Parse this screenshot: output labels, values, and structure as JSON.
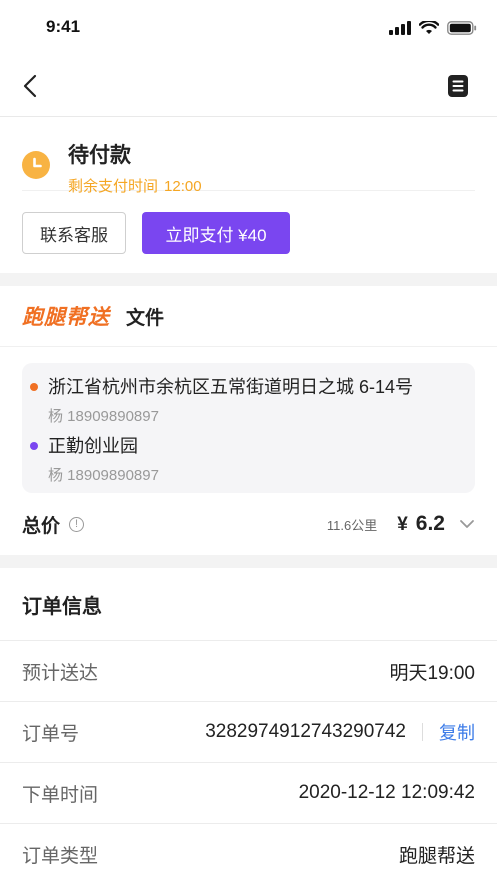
{
  "status_bar": {
    "time": "9:41"
  },
  "order_status": {
    "title": "待付款",
    "remaining_label": "剩余支付时间",
    "remaining_time": "12:00"
  },
  "actions": {
    "contact_label": "联系客服",
    "pay_label": "立即支付 ¥40"
  },
  "service": {
    "brand": "跑腿帮送",
    "type": "文件"
  },
  "addresses": [
    {
      "address": "浙江省杭州市余杭区五常街道明日之城 6-14号",
      "contact": "杨 18909890897"
    },
    {
      "address": "正勤创业园",
      "contact": "杨 18909890897"
    }
  ],
  "total": {
    "label": "总价",
    "distance": "11.6公里",
    "currency": "¥",
    "price": "6.2"
  },
  "order_info": {
    "title": "订单信息",
    "eta_label": "预计送达",
    "eta_value": "明天19:00",
    "order_no_label": "订单号",
    "order_no_value": "3282974912743290742",
    "copy_label": "复制",
    "time_label": "下单时间",
    "time_value": "2020-12-12 12:09:42",
    "type_label": "订单类型",
    "type_value": "跑腿帮送"
  },
  "colors": {
    "accent": "#7a46f0",
    "warning": "#f5a623",
    "brand_orange": "#f07023",
    "link": "#3b7be8"
  }
}
